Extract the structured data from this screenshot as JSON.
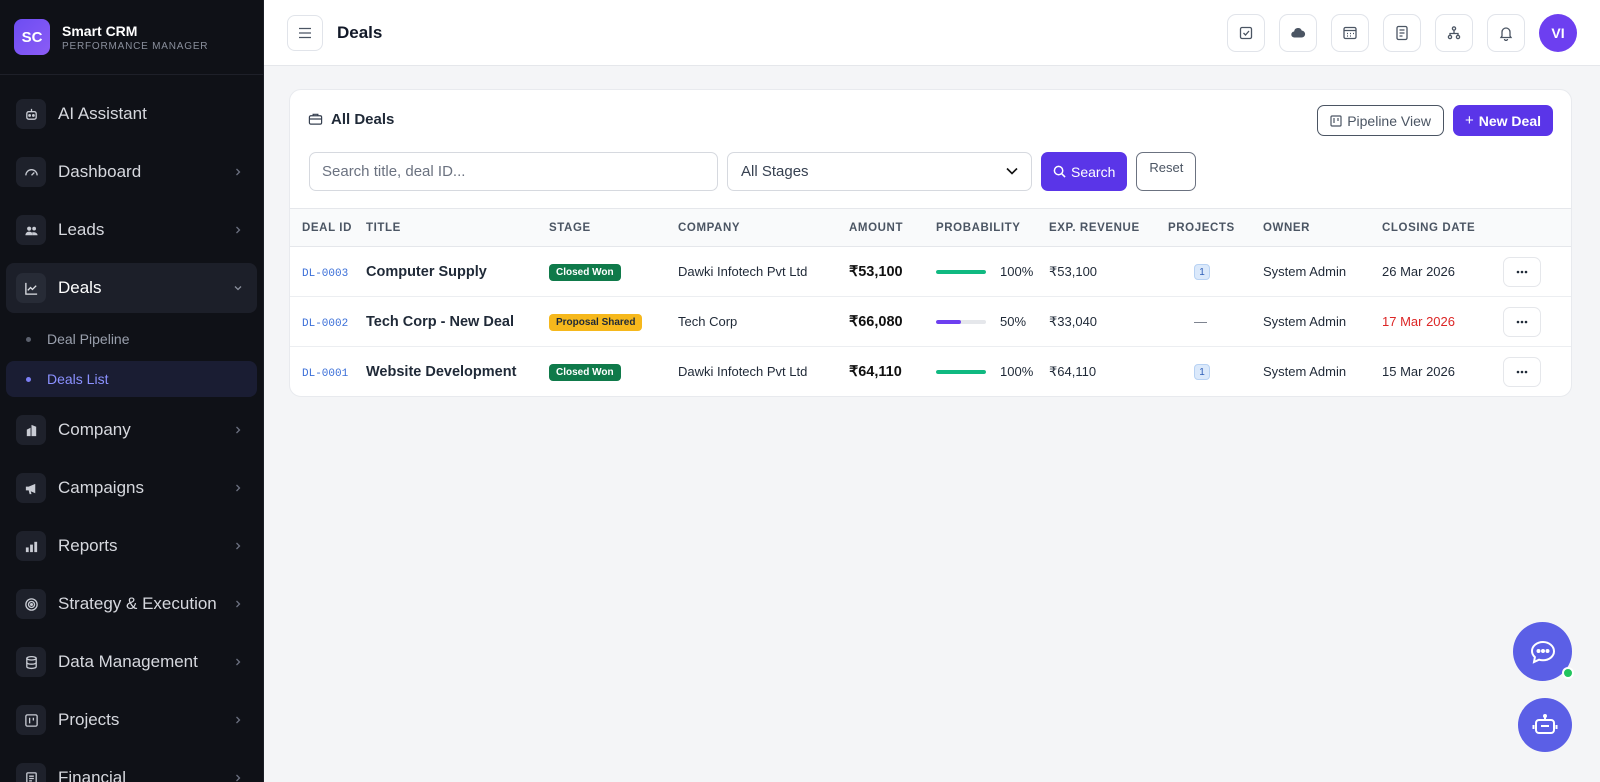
{
  "brand": {
    "initials": "SC",
    "name": "Smart CRM",
    "subtitle": "PERFORMANCE MANAGER"
  },
  "sidebar": {
    "items": [
      {
        "label": "AI Assistant",
        "icon": "robot-icon",
        "chevron": false
      },
      {
        "label": "Dashboard",
        "icon": "gauge-icon",
        "chevron": true
      },
      {
        "label": "Leads",
        "icon": "users-icon",
        "chevron": true
      },
      {
        "label": "Deals",
        "icon": "chart-line-icon",
        "chevron": true,
        "active": true,
        "expanded": true,
        "children": [
          {
            "label": "Deal Pipeline"
          },
          {
            "label": "Deals List",
            "active": true
          }
        ]
      },
      {
        "label": "Company",
        "icon": "building-icon",
        "chevron": true
      },
      {
        "label": "Campaigns",
        "icon": "megaphone-icon",
        "chevron": true
      },
      {
        "label": "Reports",
        "icon": "bar-chart-icon",
        "chevron": true
      },
      {
        "label": "Strategy & Execution",
        "icon": "target-icon",
        "chevron": true
      },
      {
        "label": "Data Management",
        "icon": "database-icon",
        "chevron": true
      },
      {
        "label": "Projects",
        "icon": "kanban-icon",
        "chevron": true
      },
      {
        "label": "Financial",
        "icon": "receipt-icon",
        "chevron": true
      }
    ]
  },
  "topbar": {
    "title": "Deals",
    "icons": [
      "task-check-icon",
      "cloud-icon",
      "calendar-window-icon",
      "checklist-icon",
      "hierarchy-icon",
      "bell-icon"
    ],
    "avatar": "VI"
  },
  "card": {
    "title": "All Deals",
    "pipeline_view": "Pipeline View",
    "new_deal": "New Deal",
    "search_placeholder": "Search title, deal ID...",
    "stage_select": "All Stages",
    "search_button": "Search",
    "reset_button": "Reset"
  },
  "table": {
    "columns": [
      "DEAL ID",
      "TITLE",
      "STAGE",
      "COMPANY",
      "AMOUNT",
      "PROBABILITY",
      "EXP. REVENUE",
      "PROJECTS",
      "OWNER",
      "CLOSING DATE"
    ],
    "rows": [
      {
        "id": "DL-0003",
        "title": "Computer Supply",
        "stage": "Closed Won",
        "company": "Dawki Infotech Pvt Ltd",
        "amount": "₹53,100",
        "probability": 100,
        "probability_label": "100%",
        "exp_revenue": "₹53,100",
        "projects": "1",
        "owner": "System Admin",
        "closing_date": "26 Mar 2026",
        "overdue": false
      },
      {
        "id": "DL-0002",
        "title": "Tech Corp - New Deal",
        "stage": "Proposal Shared",
        "company": "Tech Corp",
        "amount": "₹66,080",
        "probability": 50,
        "probability_label": "50%",
        "exp_revenue": "₹33,040",
        "projects": "—",
        "owner": "System Admin",
        "closing_date": "17 Mar 2026",
        "overdue": true
      },
      {
        "id": "DL-0001",
        "title": "Website Development",
        "stage": "Closed Won",
        "company": "Dawki Infotech Pvt Ltd",
        "amount": "₹64,110",
        "probability": 100,
        "probability_label": "100%",
        "exp_revenue": "₹64,110",
        "projects": "1",
        "owner": "System Admin",
        "closing_date": "15 Mar 2026",
        "overdue": false
      }
    ]
  },
  "colors": {
    "accent": "#5a35e8",
    "closed_won": "#0f7a4a",
    "proposal": "#f6b81c",
    "overdue": "#dc2626",
    "bar_full": "#10b981",
    "bar_partial": "#6d3ff0"
  }
}
